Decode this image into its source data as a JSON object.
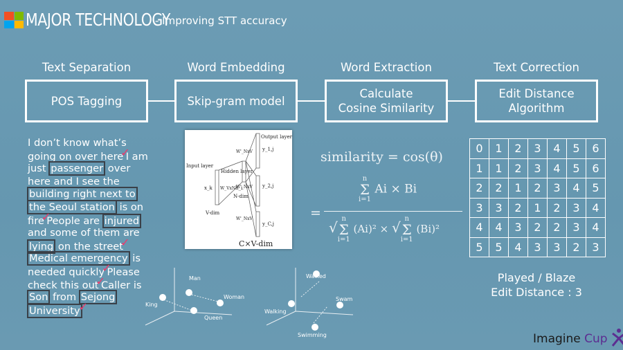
{
  "header": {
    "title": "MAJOR TECHNOLOGY",
    "subtitle": "- Improving STT accuracy",
    "logo_colors": [
      "#f25022",
      "#7fba00",
      "#00a4ef",
      "#ffb900"
    ]
  },
  "pipeline": [
    {
      "label": "Text Separation",
      "box": "POS Tagging"
    },
    {
      "label": "Word Embedding",
      "box": "Skip-gram model"
    },
    {
      "label": "Word Extraction",
      "box": "Calculate\nCosine Similarity"
    },
    {
      "label": "Text Correction",
      "box": "Edit Distance\nAlgorithm"
    }
  ],
  "paragraph": {
    "check_color": "#f0386b",
    "lines": [
      [
        {
          "t": "I don’t know what’s"
        }
      ],
      [
        {
          "t": "going on over here"
        },
        {
          "check": true
        },
        {
          "t": "I am"
        }
      ],
      [
        {
          "t": "just "
        },
        {
          "t": "passenger",
          "box": true
        },
        {
          "t": " over"
        }
      ],
      [
        {
          "t": "here and I see the"
        }
      ],
      [
        {
          "t": "building right next to",
          "box": true
        }
      ],
      [
        {
          "t": "the Seoul station",
          "box": true
        },
        {
          "t": " is on"
        }
      ],
      [
        {
          "t": "fire"
        },
        {
          "check": true
        },
        {
          "t": "People are "
        },
        {
          "t": "injured",
          "box": true
        }
      ],
      [
        {
          "t": "and some of them are"
        }
      ],
      [
        {
          "t": "lying",
          "box": true
        },
        {
          "t": " on the street"
        },
        {
          "check": true
        }
      ],
      [
        {
          "t": "Medical emergency",
          "box": true
        },
        {
          "t": " is"
        }
      ],
      [
        {
          "t": "needed quickly"
        },
        {
          "check": true
        },
        {
          "t": "Please"
        }
      ],
      [
        {
          "t": "check this out"
        },
        {
          "check": true
        },
        {
          "t": "Caller is"
        }
      ],
      [
        {
          "t": "Son",
          "box": true
        },
        {
          "t": " from "
        },
        {
          "t": "Sejong",
          "box": true
        }
      ],
      [
        {
          "t": "University",
          "box": true
        },
        {
          "check": true
        }
      ]
    ]
  },
  "skipgram": {
    "output_layer": "Output layer",
    "input_layer": "Input layer",
    "hidden_layer": "Hidden layer",
    "x": "x_k",
    "h": "h_i",
    "w_in": "W_VxN",
    "w_out": "W'_NxV",
    "y1": "y_1,j",
    "y2": "y_2,j",
    "yc": "y_C,j",
    "vdim": "V-dim",
    "ndim": "N-dim",
    "cvdim": "C×V-dim"
  },
  "formula": {
    "lhs": "similarity = cos(θ)",
    "num": "Ai × Bi",
    "den_a": "(Ai)²",
    "den_b": "(Bi)²",
    "sum_top": "n",
    "sum_bot": "i=1"
  },
  "edit_table": [
    [
      0,
      1,
      2,
      3,
      4,
      5,
      6
    ],
    [
      1,
      1,
      2,
      3,
      4,
      5,
      6
    ],
    [
      2,
      2,
      1,
      2,
      3,
      4,
      5
    ],
    [
      3,
      3,
      2,
      1,
      2,
      3,
      4
    ],
    [
      4,
      4,
      3,
      2,
      2,
      3,
      4
    ],
    [
      5,
      5,
      4,
      3,
      3,
      2,
      3
    ]
  ],
  "result": {
    "pair": "Played / Blaze",
    "distance": "Edit Distance : 3"
  },
  "plots": {
    "left": [
      "Man",
      "Woman",
      "King",
      "Queen"
    ],
    "right": [
      "Walked",
      "Swam",
      "Walking",
      "Swimming"
    ]
  },
  "brand": {
    "imagine": "Imagine",
    "cup": "Cup",
    "color": "#5c2d91"
  }
}
